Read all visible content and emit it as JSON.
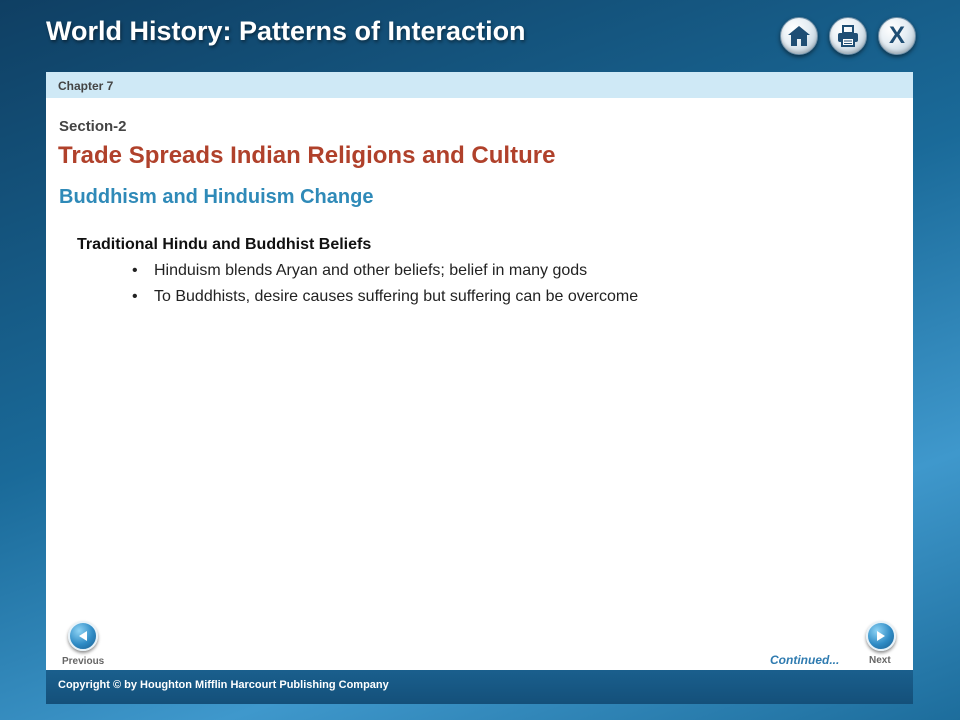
{
  "header": {
    "title": "World History: Patterns of Interaction",
    "buttons": {
      "home_icon": "home-icon",
      "print_icon": "printer-icon",
      "close_label": "X"
    }
  },
  "panel": {
    "chapter": "Chapter 7",
    "section_label": "Section-2",
    "section_title": "Trade Spreads Indian Religions and Culture",
    "subtopic": "Buddhism and Hinduism Change",
    "content": {
      "heading": "Traditional Hindu and Buddhist Beliefs",
      "bullets": [
        "Hinduism blends Aryan and other beliefs; belief in many gods",
        "To Buddhists, desire causes suffering but suffering can be overcome"
      ]
    }
  },
  "navigation": {
    "previous_label": "Previous",
    "next_label": "Next",
    "continued_label": "Continued..."
  },
  "footer": {
    "copyright": "Copyright © by Houghton Mifflin Harcourt Publishing Company"
  },
  "colors": {
    "section_title": "#b0412b",
    "subtopic": "#2f8ab8",
    "chapter_bar": "#cfe9f6",
    "footer_bar": "#1a5f8d"
  }
}
